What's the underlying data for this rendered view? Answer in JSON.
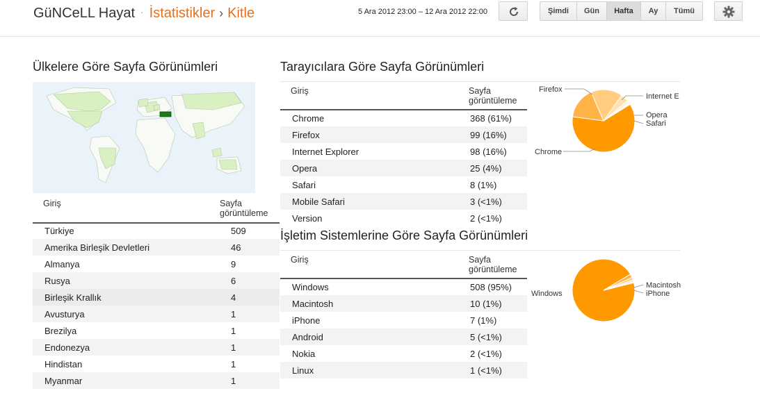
{
  "header": {
    "blog_title": "GüNCeLL Hayat",
    "dot": "·",
    "crumb1": "İstatistikler",
    "sep": "›",
    "crumb2": "Kitle",
    "date_range": "5 Ara 2012 23:00 – 12 Ara 2012 22:00",
    "ranges": [
      "Şimdi",
      "Gün",
      "Hafta",
      "Ay",
      "Tümü"
    ],
    "active_range": "Hafta"
  },
  "countries": {
    "title": "Ülkelere Göre Sayfa Görünümleri",
    "col_entry": "Giriş",
    "col_views": "Sayfa görüntüleme",
    "rows": [
      {
        "name": "Türkiye",
        "value": "509"
      },
      {
        "name": "Amerika Birleşik Devletleri",
        "value": "46"
      },
      {
        "name": "Almanya",
        "value": "9"
      },
      {
        "name": "Rusya",
        "value": "6"
      },
      {
        "name": "Birleşik Krallık",
        "value": "4"
      },
      {
        "name": "Avusturya",
        "value": "1"
      },
      {
        "name": "Brezilya",
        "value": "1"
      },
      {
        "name": "Endonezya",
        "value": "1"
      },
      {
        "name": "Hindistan",
        "value": "1"
      },
      {
        "name": "Myanmar",
        "value": "1"
      }
    ]
  },
  "browsers": {
    "title": "Tarayıcılara Göre Sayfa Görünümleri",
    "col_entry": "Giriş",
    "col_views": "Sayfa görüntüleme",
    "rows": [
      {
        "name": "Chrome",
        "value": "368 (61%)"
      },
      {
        "name": "Firefox",
        "value": "99 (16%)"
      },
      {
        "name": "Internet Explorer",
        "value": "98 (16%)"
      },
      {
        "name": "Opera",
        "value": "25 (4%)"
      },
      {
        "name": "Safari",
        "value": "8 (1%)"
      },
      {
        "name": "Mobile Safari",
        "value": "3 (<1%)"
      },
      {
        "name": "Version",
        "value": "2 (<1%)"
      }
    ],
    "pie_labels": [
      "Firefox",
      "Internet E",
      "Opera",
      "Safari",
      "Chrome"
    ]
  },
  "os": {
    "title": "İşletim Sistemlerine Göre Sayfa Görünümleri",
    "col_entry": "Giriş",
    "col_views": "Sayfa görüntüleme",
    "rows": [
      {
        "name": "Windows",
        "value": "508 (95%)"
      },
      {
        "name": "Macintosh",
        "value": "10 (1%)"
      },
      {
        "name": "iPhone",
        "value": "7 (1%)"
      },
      {
        "name": "Android",
        "value": "5 (<1%)"
      },
      {
        "name": "Nokia",
        "value": "2 (<1%)"
      },
      {
        "name": "Linux",
        "value": "1 (<1%)"
      }
    ],
    "pie_labels": [
      "Windows",
      "Macintosh",
      "iPhone"
    ]
  },
  "chart_data": [
    {
      "type": "pie",
      "title": "",
      "categories": [
        "Chrome",
        "Firefox",
        "Internet Explorer",
        "Opera",
        "Safari",
        "Mobile Safari",
        "Version"
      ],
      "values": [
        368,
        99,
        98,
        25,
        8,
        3,
        2
      ],
      "colors": [
        "#ff9900",
        "#ffb347",
        "#ffcc80",
        "#ffe0b0",
        "#fff0d8",
        "#fff6e8",
        "#fffaf2"
      ]
    },
    {
      "type": "pie",
      "title": "",
      "categories": [
        "Windows",
        "Macintosh",
        "iPhone",
        "Android",
        "Nokia",
        "Linux"
      ],
      "values": [
        508,
        10,
        7,
        5,
        2,
        1
      ],
      "colors": [
        "#ff9900",
        "#ffb347",
        "#ffcc80",
        "#ffe0b0",
        "#fff0d8",
        "#fffaf2"
      ]
    }
  ]
}
